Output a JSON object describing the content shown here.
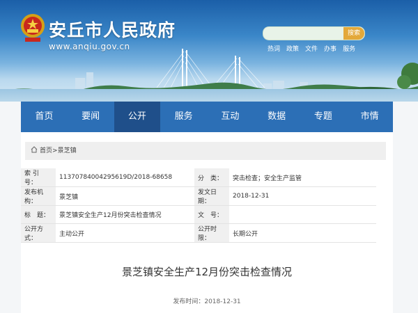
{
  "header": {
    "site_title": "安丘市人民政府",
    "domain": "www.anqiu.gov.cn",
    "search_placeholder": "",
    "search_button": "搜索",
    "hot_links": [
      "热词",
      "政策",
      "文件",
      "办事",
      "服务"
    ]
  },
  "nav": {
    "items": [
      "首页",
      "要闻",
      "公开",
      "服务",
      "互动",
      "数据",
      "专题",
      "市情"
    ],
    "active": "公开"
  },
  "breadcrumb": {
    "home": "首页",
    "separator": ">",
    "current": "景芝镇"
  },
  "meta": {
    "rows": [
      {
        "l1": "索 引 号：",
        "v1": "11370784004295619D/2018-68658",
        "l2": "分　类：",
        "v2": "突击检查；安全生产监管"
      },
      {
        "l1": "发布机构：",
        "v1": "景芝镇",
        "l2": "发文日期：",
        "v2": "2018-12-31"
      },
      {
        "l1": "标　题：",
        "v1": "景芝镇安全生产12月份突击检查情况",
        "l2": "文　号：",
        "v2": ""
      },
      {
        "l1": "公开方式：",
        "v1": "主动公开",
        "l2": "公开时限：",
        "v2": "长期公开"
      }
    ]
  },
  "article": {
    "title": "景芝镇安全生产12月份突击检查情况",
    "pubdate": "发布时间：2018-12-31"
  },
  "colors": {
    "nav": "#2c6fb6",
    "nav_active": "#1f4f8a",
    "search_button": "#e3a83a"
  }
}
